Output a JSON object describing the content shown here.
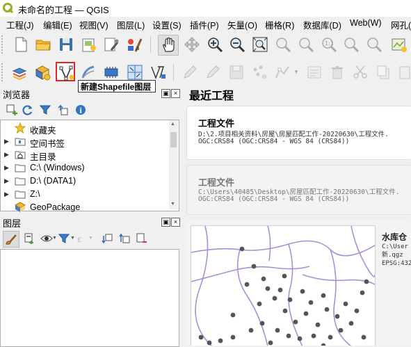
{
  "window": {
    "title": "未命名的工程 — QGIS"
  },
  "menu": [
    "工程(J)",
    "编辑(E)",
    "视图(V)",
    "图层(L)",
    "设置(S)",
    "插件(P)",
    "矢量(O)",
    "栅格(R)",
    "数据库(D)",
    "Web(W)",
    "网孔("
  ],
  "tooltip": "新建Shapefile图层",
  "browser": {
    "title": "浏览器",
    "items": [
      {
        "label": "收藏夹",
        "icon": "star-icon",
        "expandable": false
      },
      {
        "label": "空间书签",
        "icon": "bookmark-folder-icon",
        "expandable": true
      },
      {
        "label": "主目录",
        "icon": "home-folder-icon",
        "expandable": true
      },
      {
        "label": "C:\\ (Windows)",
        "icon": "folder-icon",
        "expandable": true
      },
      {
        "label": "D:\\ (DATA1)",
        "icon": "folder-icon",
        "expandable": true
      },
      {
        "label": "Z:\\",
        "icon": "folder-icon",
        "expandable": true
      },
      {
        "label": "GeoPackage",
        "icon": "geopackage-icon",
        "expandable": false
      }
    ]
  },
  "layers": {
    "title": "图层"
  },
  "recent": {
    "title": "最近工程",
    "projects": [
      {
        "name": "工程文件",
        "path": "D:\\2.项目相关资料\\房屋\\房屋匹配工作-20220630\\工程文件.",
        "crs": "OGC:CRS84 (OGC:CRS84 - WGS 84 (CRS84))"
      },
      {
        "name": "工程文件",
        "path": "C:\\Users\\40485\\Desktop\\房屋匹配工作-20220630\\工程文件.",
        "crs": "OGC:CRS84 (OGC:CRS84 - WGS 84 (CRS84))"
      },
      {
        "name": "水库仓",
        "path": "C:\\User",
        "file": "新.qgz",
        "crs": "EPSG:432"
      }
    ]
  }
}
